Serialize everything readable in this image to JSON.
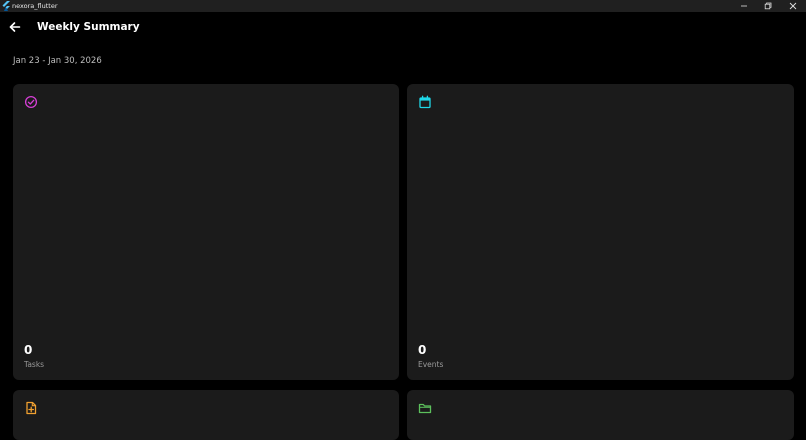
{
  "window": {
    "title": "nexora_flutter",
    "minimize_icon": "minimize-icon",
    "maximize_icon": "restore-icon",
    "close_icon": "close-icon"
  },
  "header": {
    "back_icon": "arrow-left-icon",
    "title": "Weekly Summary"
  },
  "date_range": "Jan 23 - Jan 30, 2026",
  "cards": [
    {
      "icon": "check-circle-icon",
      "color": "#d63fd6",
      "count": "0",
      "label": "Tasks"
    },
    {
      "icon": "calendar-icon",
      "color": "#1fd8e8",
      "count": "0",
      "label": "Events"
    },
    {
      "icon": "note-add-icon",
      "color": "#f0a030",
      "count": "",
      "label": ""
    },
    {
      "icon": "folder-icon",
      "color": "#5cc05c",
      "count": "",
      "label": ""
    }
  ]
}
